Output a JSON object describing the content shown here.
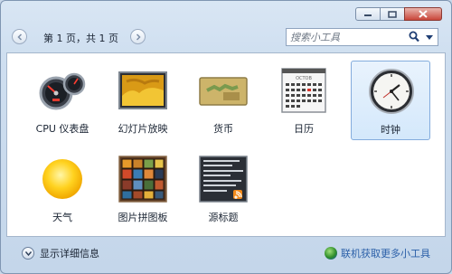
{
  "titlebar": {
    "buttons": [
      "minimize-icon",
      "maximize-icon",
      "close-icon"
    ]
  },
  "nav": {
    "page_label": "第 1 页，共 1 页"
  },
  "search": {
    "placeholder": "搜索小工具"
  },
  "gadgets": [
    {
      "label": "CPU 仪表盘",
      "icon": "cpu-meter-icon",
      "selected": false
    },
    {
      "label": "幻灯片放映",
      "icon": "slideshow-icon",
      "selected": false
    },
    {
      "label": "货币",
      "icon": "currency-icon",
      "selected": false
    },
    {
      "label": "日历",
      "icon": "calendar-icon",
      "selected": false
    },
    {
      "label": "时钟",
      "icon": "clock-icon",
      "selected": true
    },
    {
      "label": "天气",
      "icon": "weather-icon",
      "selected": false
    },
    {
      "label": "图片拼图板",
      "icon": "puzzle-icon",
      "selected": false
    },
    {
      "label": "源标题",
      "icon": "feed-headlines-icon",
      "selected": false
    }
  ],
  "calendar_icon_text": {
    "month": "OCTOB"
  },
  "footer": {
    "details_label": "显示详细信息",
    "get_more_label": "联机获取更多小工具"
  },
  "colors": {
    "accent": "#2a5fa8",
    "selection": "#d4e8fb",
    "window_frame": "#c4d6ea"
  }
}
